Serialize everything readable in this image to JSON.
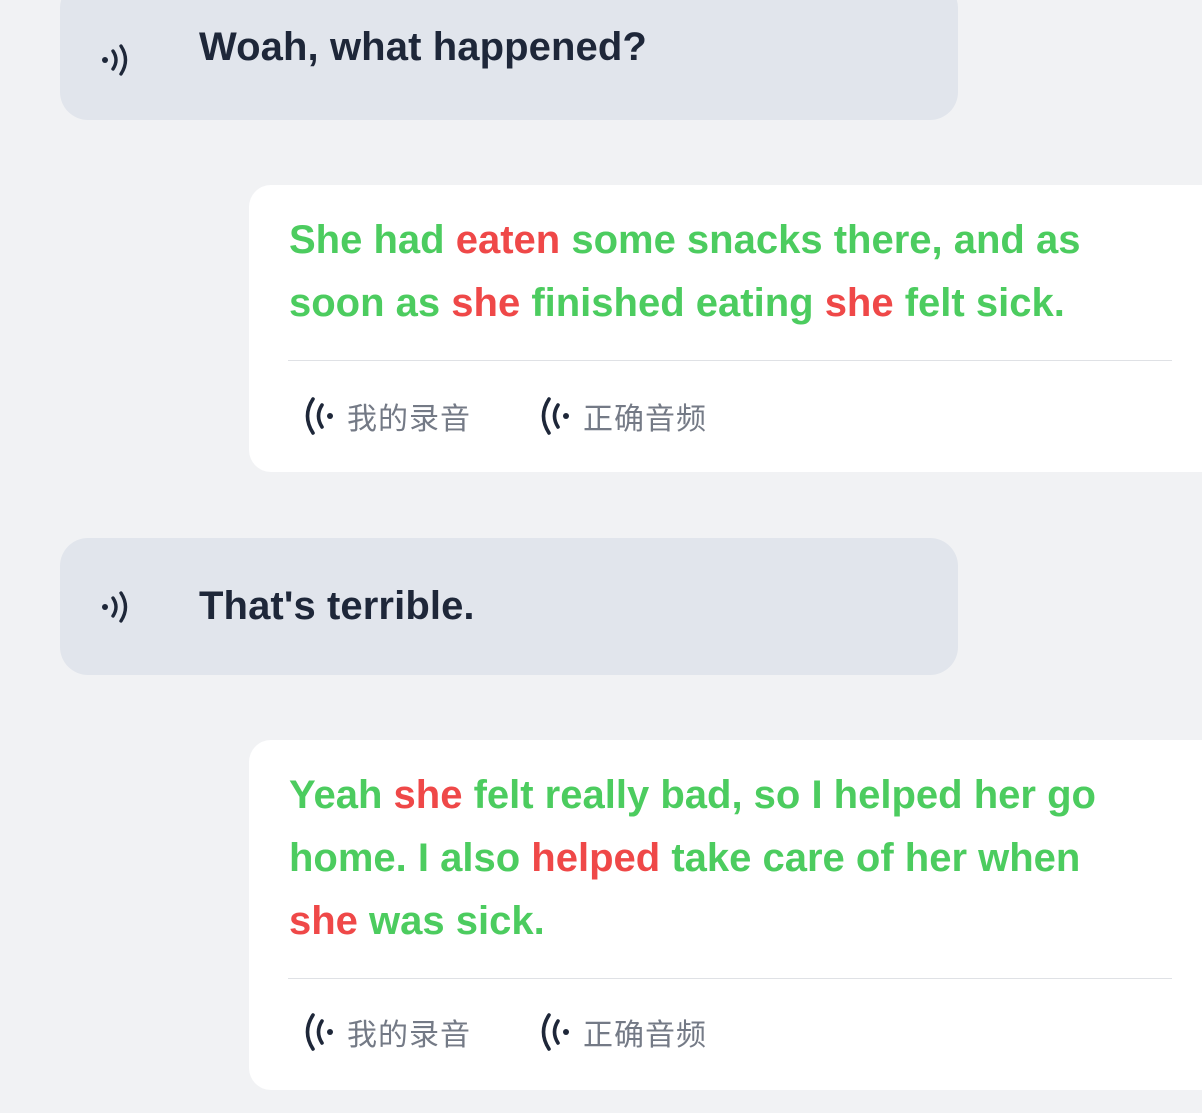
{
  "dialog": [
    {
      "type": "prompt",
      "text": "Woah, what happened?",
      "icon": "speaker-icon"
    },
    {
      "type": "answer",
      "words": [
        {
          "t": "She had ",
          "status": "ok"
        },
        {
          "t": "eaten",
          "status": "bad"
        },
        {
          "t": " some snacks there, and as soon as ",
          "status": "ok"
        },
        {
          "t": "she",
          "status": "bad"
        },
        {
          "t": " finished eating ",
          "status": "ok"
        },
        {
          "t": "she",
          "status": "bad"
        },
        {
          "t": " felt sick.",
          "status": "ok"
        }
      ],
      "actions": {
        "my_recording": "我的录音",
        "correct_audio": "正确音频"
      }
    },
    {
      "type": "prompt",
      "text": "That's terrible.",
      "icon": "speaker-icon"
    },
    {
      "type": "answer",
      "words": [
        {
          "t": "Yeah ",
          "status": "ok"
        },
        {
          "t": "she",
          "status": "bad"
        },
        {
          "t": " felt really bad, so I helped her go home. I also ",
          "status": "ok"
        },
        {
          "t": "helped",
          "status": "bad"
        },
        {
          "t": " take care of her when ",
          "status": "ok"
        },
        {
          "t": "she",
          "status": "bad"
        },
        {
          "t": " was sick.",
          "status": "ok"
        }
      ],
      "actions": {
        "my_recording": "我的录音",
        "correct_audio": "正确音频"
      }
    }
  ],
  "colors": {
    "correct": "#4ccc5f",
    "incorrect": "#ef4848",
    "prompt_bg": "#e1e5ec",
    "card_bg": "#ffffff",
    "page_bg": "#f1f2f4"
  },
  "icons": {
    "prompt_play": "speaker-icon",
    "my_recording": "wave-icon",
    "correct_audio": "wave-icon"
  }
}
